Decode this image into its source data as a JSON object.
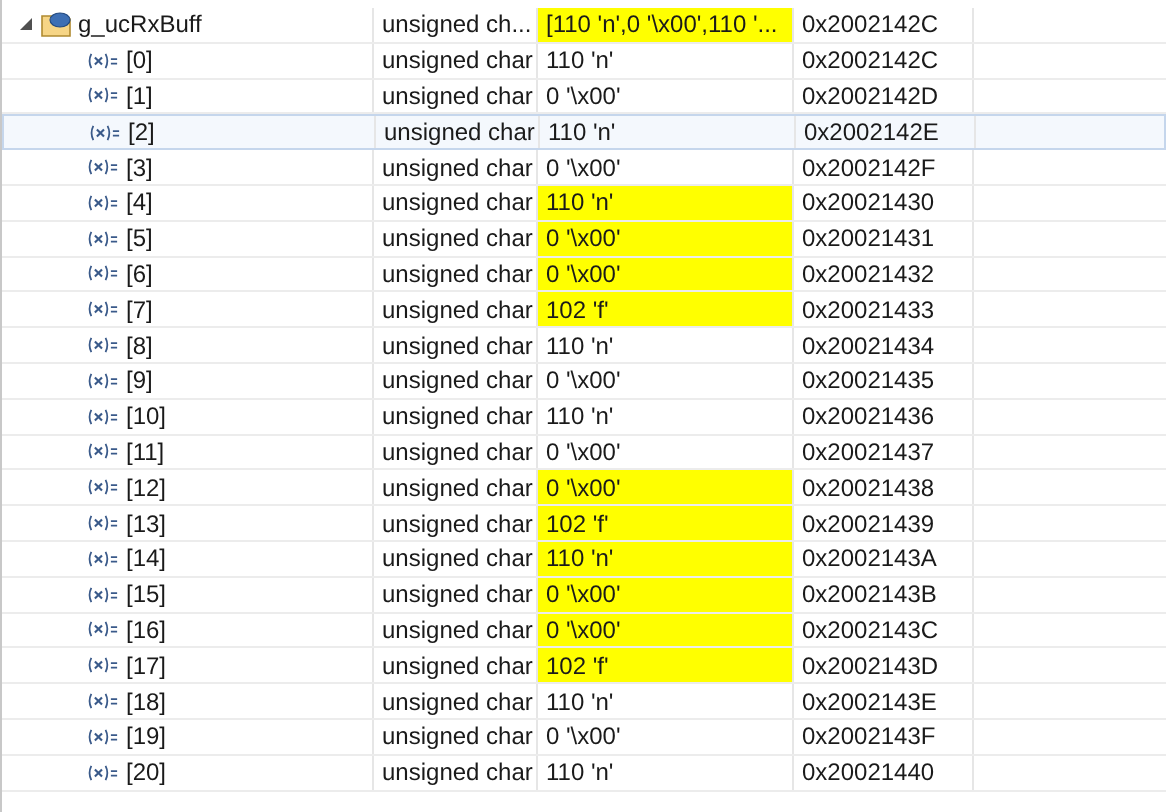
{
  "expressions": [
    {
      "name": "g_ucRxBuff",
      "type": "unsigned ch...",
      "value": "[110 'n',0 '\\x00',110 '...",
      "address": "0x2002142C",
      "changed": true,
      "expanded": true,
      "selected": false,
      "children": [
        {
          "name": "[0]",
          "type": "unsigned char",
          "value": "110 'n'",
          "address": "0x2002142C",
          "changed": false,
          "selected": false
        },
        {
          "name": "[1]",
          "type": "unsigned char",
          "value": "0 '\\x00'",
          "address": "0x2002142D",
          "changed": false,
          "selected": false
        },
        {
          "name": "[2]",
          "type": "unsigned char",
          "value": "110 'n'",
          "address": "0x2002142E",
          "changed": false,
          "selected": true
        },
        {
          "name": "[3]",
          "type": "unsigned char",
          "value": "0 '\\x00'",
          "address": "0x2002142F",
          "changed": false,
          "selected": false
        },
        {
          "name": "[4]",
          "type": "unsigned char",
          "value": "110 'n'",
          "address": "0x20021430",
          "changed": true,
          "selected": false
        },
        {
          "name": "[5]",
          "type": "unsigned char",
          "value": "0 '\\x00'",
          "address": "0x20021431",
          "changed": true,
          "selected": false
        },
        {
          "name": "[6]",
          "type": "unsigned char",
          "value": "0 '\\x00'",
          "address": "0x20021432",
          "changed": true,
          "selected": false
        },
        {
          "name": "[7]",
          "type": "unsigned char",
          "value": "102 'f'",
          "address": "0x20021433",
          "changed": true,
          "selected": false
        },
        {
          "name": "[8]",
          "type": "unsigned char",
          "value": "110 'n'",
          "address": "0x20021434",
          "changed": false,
          "selected": false
        },
        {
          "name": "[9]",
          "type": "unsigned char",
          "value": "0 '\\x00'",
          "address": "0x20021435",
          "changed": false,
          "selected": false
        },
        {
          "name": "[10]",
          "type": "unsigned char",
          "value": "110 'n'",
          "address": "0x20021436",
          "changed": false,
          "selected": false
        },
        {
          "name": "[11]",
          "type": "unsigned char",
          "value": "0 '\\x00'",
          "address": "0x20021437",
          "changed": false,
          "selected": false
        },
        {
          "name": "[12]",
          "type": "unsigned char",
          "value": "0 '\\x00'",
          "address": "0x20021438",
          "changed": true,
          "selected": false
        },
        {
          "name": "[13]",
          "type": "unsigned char",
          "value": "102 'f'",
          "address": "0x20021439",
          "changed": true,
          "selected": false
        },
        {
          "name": "[14]",
          "type": "unsigned char",
          "value": "110 'n'",
          "address": "0x2002143A",
          "changed": true,
          "selected": false
        },
        {
          "name": "[15]",
          "type": "unsigned char",
          "value": "0 '\\x00'",
          "address": "0x2002143B",
          "changed": true,
          "selected": false
        },
        {
          "name": "[16]",
          "type": "unsigned char",
          "value": "0 '\\x00'",
          "address": "0x2002143C",
          "changed": true,
          "selected": false
        },
        {
          "name": "[17]",
          "type": "unsigned char",
          "value": "102 'f'",
          "address": "0x2002143D",
          "changed": true,
          "selected": false
        },
        {
          "name": "[18]",
          "type": "unsigned char",
          "value": "110 'n'",
          "address": "0x2002143E",
          "changed": false,
          "selected": false
        },
        {
          "name": "[19]",
          "type": "unsigned char",
          "value": "0 '\\x00'",
          "address": "0x2002143F",
          "changed": false,
          "selected": false
        },
        {
          "name": "[20]",
          "type": "unsigned char",
          "value": "110 'n'",
          "address": "0x20021440",
          "changed": false,
          "selected": false
        }
      ]
    }
  ]
}
